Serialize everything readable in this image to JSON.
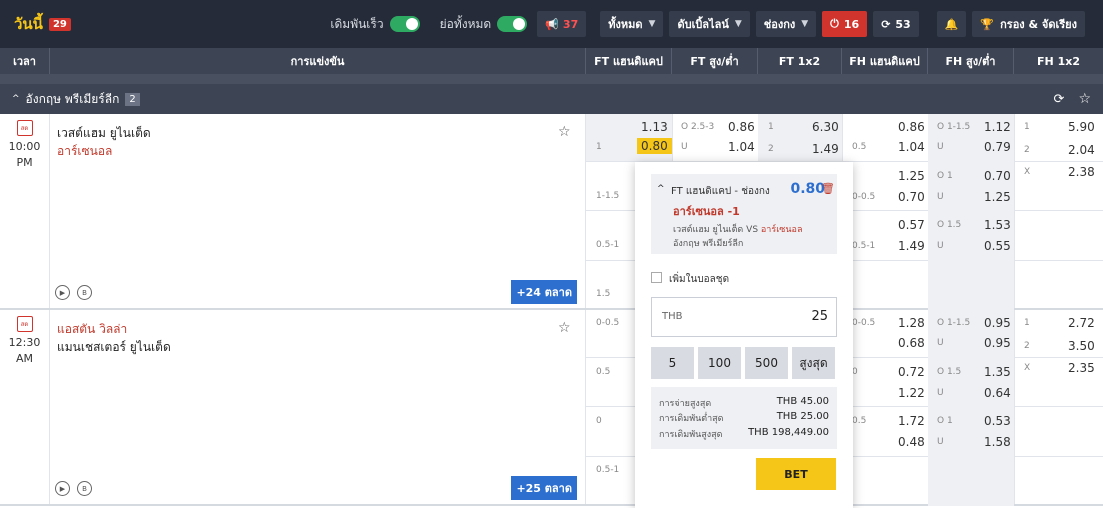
{
  "topbar": {
    "today_label": "วันนี้",
    "today_count": "29",
    "quick_bet_label": "เดิมพันเร็ว",
    "collapse_label": "ย่อทั้งหมด",
    "announce_count": "37",
    "filter_all": "ทั้งหมด",
    "filter_double": "ดับเบิ้ลไลน์",
    "filter_sort": "ช่องกง",
    "live_count": "16",
    "refresh_count": "53",
    "filter_label": "กรอง & จัดเรียง"
  },
  "columns": {
    "time": "เวลา",
    "match": "การแข่งขัน",
    "ft_hdp": "FT แฮนดิแคป",
    "ft_ou": "FT สูง/ต่ำ",
    "ft_1x2": "FT 1x2",
    "fh_hdp": "FH แฮนดิแคป",
    "fh_ou": "FH สูง/ต่ำ",
    "fh_1x2": "FH 1x2"
  },
  "league": {
    "name": "อังกฤษ พรีเมียร์ลีก",
    "count": "2"
  },
  "matches": [
    {
      "live_tag": "สด",
      "time": "10:00",
      "ampm": "PM",
      "home": "เวสต์แฮม ยูไนเต็ด",
      "away": "อาร์เซนอล",
      "more": "+24 ตลาด",
      "ft_hdp": [
        {
          "line": "1",
          "home": "1.13",
          "away": "0.80"
        },
        {
          "line": "1-1.5",
          "home": "",
          "away": ""
        },
        {
          "line": "0.5-1",
          "home": "",
          "away": ""
        },
        {
          "line": "1.5",
          "home": "",
          "away": ""
        }
      ],
      "ft_ou": {
        "line_o": "O 2.5-3",
        "o": "0.86",
        "line_u": "U",
        "u": "1.04"
      },
      "ft_1x2": {
        "l1": "1",
        "v1": "6.30",
        "l2": "2",
        "v2": "1.49"
      },
      "fh_hdp": [
        {
          "line": "0.5",
          "home": "0.86",
          "away": "1.04"
        },
        {
          "line": "0-0.5",
          "home": "1.25",
          "away": "0.70"
        },
        {
          "line": "0.5-1",
          "home": "0.57",
          "away": "1.49"
        }
      ],
      "fh_ou": [
        {
          "line_o": "O 1-1.5",
          "o": "1.12",
          "u": "0.79"
        },
        {
          "line_o": "O 1",
          "o": "0.70",
          "u": "1.25"
        },
        {
          "line_o": "O 1.5",
          "o": "1.53",
          "u": "0.55"
        }
      ],
      "fh_1x2": {
        "l1": "1",
        "v1": "5.90",
        "l2": "2",
        "v2": "2.04",
        "lx": "X",
        "vx": "2.38"
      }
    },
    {
      "live_tag": "สด",
      "time": "12:30",
      "ampm": "AM",
      "home": "แอสตัน วิลล่า",
      "away": "แมนเชสเตอร์ ยูไนเต็ด",
      "more": "+25 ตลาด",
      "ft_hdp_lines": [
        "0-0.5",
        "0.5",
        "0",
        "0.5-1"
      ],
      "fh_hdp": [
        {
          "line": "0-0.5",
          "home": "1.28",
          "away": "0.68"
        },
        {
          "line": "0",
          "home": "0.72",
          "away": "1.22"
        },
        {
          "line": "0.5",
          "home": "1.72",
          "away": "0.48"
        }
      ],
      "fh_ou": [
        {
          "line_o": "O 1-1.5",
          "o": "0.95",
          "u": "0.95"
        },
        {
          "line_o": "O 1.5",
          "o": "1.35",
          "u": "0.64"
        },
        {
          "line_o": "O 1",
          "o": "0.53",
          "u": "1.58"
        }
      ],
      "fh_1x2": {
        "l1": "1",
        "v1": "2.72",
        "l2": "2",
        "v2": "3.50",
        "lx": "X",
        "vx": "2.35"
      }
    }
  ],
  "slip": {
    "title": "FT แฮนดิแคป - ช่องกง",
    "odds": "0.80",
    "selection": "อาร์เซนอล -1",
    "home": "เวสต์แฮม ยูไนเต็ด",
    "vs": "VS",
    "away": "อาร์เซนอล",
    "league": "อังกฤษ พรีเมียร์ลีก",
    "add_parlay": "เพิ่มในบอลชุด",
    "currency": "THB",
    "stake": "25",
    "chips": [
      "5",
      "100",
      "500",
      "สูงสุด"
    ],
    "max_payout_label": "การจ่ายสูงสุด",
    "max_payout": "THB 45.00",
    "min_bet_label": "การเดิมพันต่ำสุด",
    "min_bet": "THB 25.00",
    "max_bet_label": "การเดิมพันสูงสุด",
    "max_bet": "THB 198,449.00",
    "bet_label": "BET"
  }
}
